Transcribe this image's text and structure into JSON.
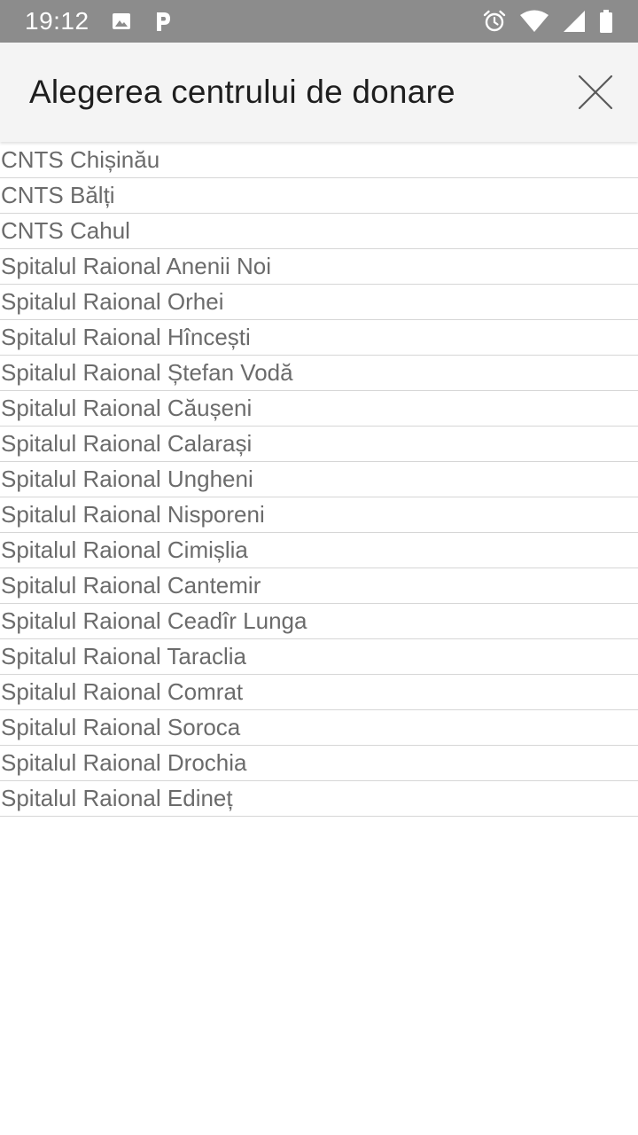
{
  "status_bar": {
    "time": "19:12",
    "left_icons": [
      "image-icon",
      "parking-p-icon"
    ],
    "right_icons": [
      "alarm-icon",
      "wifi-icon",
      "cellular-signal-icon",
      "battery-icon"
    ],
    "background_color": "#8c8c8c"
  },
  "header": {
    "title": "Alegerea centrului de donare",
    "close_icon": "close-icon",
    "background_color": "#f4f4f4"
  },
  "centers": [
    "CNTS Chișinău",
    "CNTS Bălți",
    "CNTS Cahul",
    "Spitalul Raional Anenii Noi",
    "Spitalul Raional Orhei",
    "Spitalul Raional Hîncești",
    "Spitalul Raional Ștefan Vodă",
    "Spitalul Raional Căușeni",
    "Spitalul Raional Calarași",
    "Spitalul Raional Ungheni",
    "Spitalul Raional Nisporeni",
    "Spitalul Raional Cimișlia",
    "Spitalul Raional Cantemir",
    "Spitalul Raional Ceadîr Lunga",
    "Spitalul Raional Taraclia",
    "Spitalul Raional Comrat",
    "Spitalul Raional Soroca",
    "Spitalul Raional Drochia",
    "Spitalul Raional Edineț"
  ]
}
